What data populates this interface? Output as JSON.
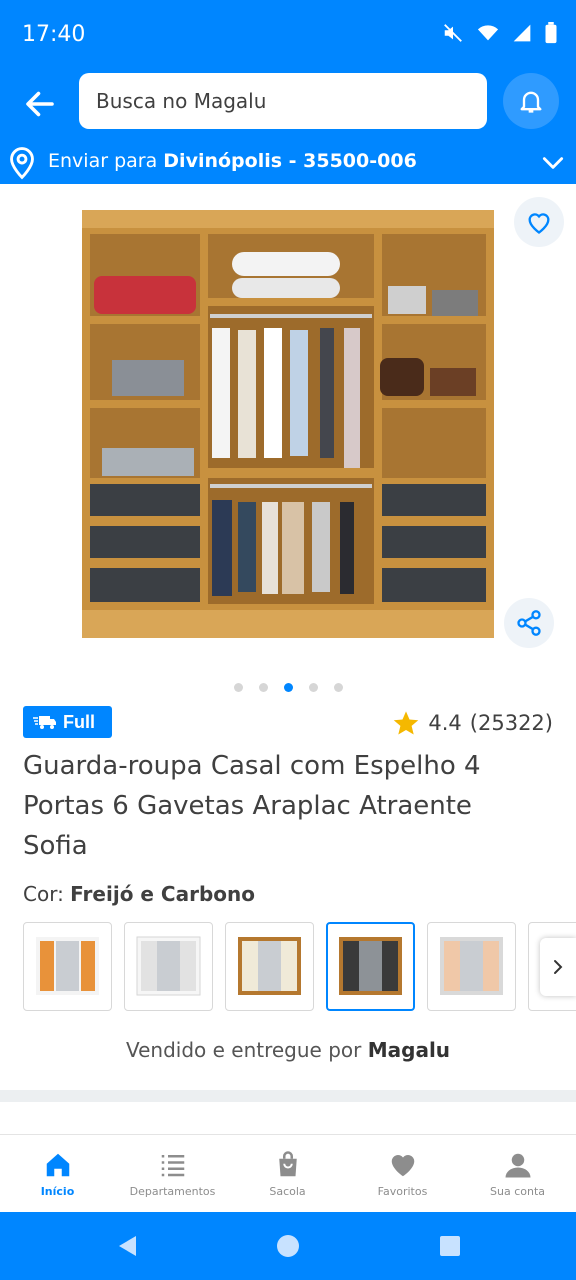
{
  "status_bar": {
    "time": "17:40"
  },
  "search": {
    "placeholder": "Busca no Magalu"
  },
  "location": {
    "prefix": "Enviar para",
    "city_cep": "Divinópolis - 35500-006"
  },
  "product": {
    "badge": "Full",
    "rating_value": "4.4",
    "rating_count": "(25322)",
    "title": "Guarda-roupa Casal com Espelho 4 Portas 6 Gavetas Araplac Atraente Sofia",
    "color_label": "Cor:",
    "color_value": "Freijó e Carbono",
    "gallery": {
      "count": 5,
      "active_index": 2
    },
    "swatches": [
      {
        "name": "orange-white",
        "frame": "#f4f4f4",
        "door": "#e8923a",
        "selected": false
      },
      {
        "name": "white",
        "frame": "#f6f6f6",
        "door": "#e2e2e2",
        "selected": false
      },
      {
        "name": "freijo-off-white",
        "frame": "#b5782f",
        "door": "#f0ead8",
        "selected": false
      },
      {
        "name": "freijo-carbono",
        "frame": "#b5782f",
        "door": "#3a3a3a",
        "selected": true
      },
      {
        "name": "rose-gray",
        "frame": "#d9d9d9",
        "door": "#f0c8a8",
        "selected": false
      }
    ]
  },
  "seller": {
    "prefix": "Vendido e entregue por",
    "name": "Magalu"
  },
  "bottom_nav": [
    {
      "label": "Início",
      "icon": "home-icon",
      "active": true
    },
    {
      "label": "Departamentos",
      "icon": "list-icon",
      "active": false
    },
    {
      "label": "Sacola",
      "icon": "bag-icon",
      "active": false
    },
    {
      "label": "Favoritos",
      "icon": "heart-icon",
      "active": false
    },
    {
      "label": "Sua conta",
      "icon": "user-icon",
      "active": false
    }
  ],
  "colors": {
    "brand": "#0086ff",
    "text": "#404040",
    "star": "#f5b800"
  }
}
